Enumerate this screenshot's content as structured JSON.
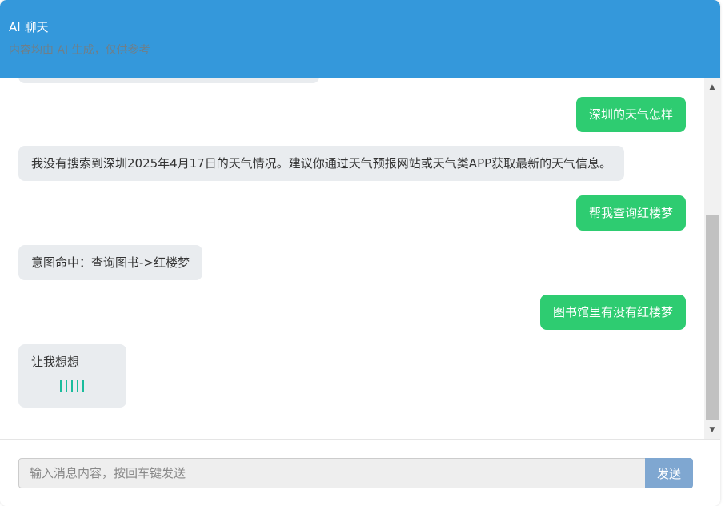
{
  "header": {
    "title": "AI 聊天",
    "subtitle": "内容均由 AI 生成，仅供参考"
  },
  "messages": [
    {
      "role": "user",
      "text": "深圳的天气怎样"
    },
    {
      "role": "bot",
      "text": "我没有搜索到深圳2025年4月17日的天气情况。建议你通过天气预报网站或天气类APP获取最新的天气信息。"
    },
    {
      "role": "user",
      "text": "帮我查询红楼梦"
    },
    {
      "role": "bot",
      "text": "意图命中：查询图书->红楼梦"
    },
    {
      "role": "user",
      "text": "图书馆里有没有红楼梦"
    },
    {
      "role": "bot",
      "text": "让我想想",
      "typing": true
    }
  ],
  "composer": {
    "placeholder": "输入消息内容，按回车键发送",
    "value": "",
    "send_label": "发送"
  },
  "colors": {
    "header_bg": "#3498db",
    "user_bubble": "#2ecc71",
    "bot_bubble": "#e9ecef",
    "send_button": "#7fa7d1",
    "typing_indicator": "#1abc9c"
  }
}
